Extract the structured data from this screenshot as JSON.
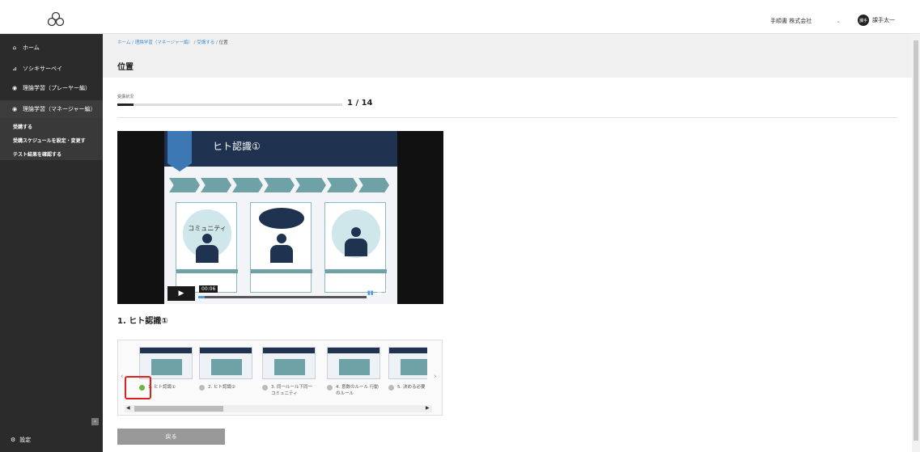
{
  "header": {
    "company": "手順書 株式会社",
    "user_initials": "課手",
    "user_name": "課手太一"
  },
  "sidebar": {
    "items": [
      {
        "icon": "home-icon",
        "glyph": "⌂",
        "label": "ホーム"
      },
      {
        "icon": "chart-icon",
        "glyph": "⊿",
        "label": "ソシキサーベイ"
      },
      {
        "icon": "play-circle-icon",
        "glyph": "◉",
        "label": "理論学習（プレーヤー編）"
      },
      {
        "icon": "play-circle-icon",
        "glyph": "◉",
        "label": "理論学習（マネージャー編）"
      }
    ],
    "sub_items": [
      "受講する",
      "受講スケジュールを設定・変更す",
      "テスト結果を確認する"
    ],
    "settings_label": "設定"
  },
  "breadcrumb": {
    "items": [
      "ホーム",
      "理論学習（マネージャー編）",
      "受講する"
    ],
    "current": "位置"
  },
  "page": {
    "title": "位置",
    "progress_label": "受講状況",
    "progress_value": 0.0714,
    "progress_count": "1 / 14"
  },
  "video": {
    "slide_title": "ヒト認識①",
    "steps": [
      "",
      "",
      "",
      "",
      "",
      "",
      ""
    ],
    "panel_text": "コミュニティ",
    "time": "00:06",
    "played_fraction": 0.04
  },
  "lesson": {
    "title": "1. ヒト認識①",
    "thumbnails": [
      {
        "label": "1. ヒト認識①",
        "done": true
      },
      {
        "label": "2. ヒト認識②",
        "done": false
      },
      {
        "label": "3. 同一ルール下同一コミュニティ",
        "done": false
      },
      {
        "label": "4. 意数のルール 行動のルール",
        "done": false
      },
      {
        "label": "5. 決める必要",
        "done": false
      }
    ]
  },
  "buttons": {
    "back_label": "戻る"
  },
  "colors": {
    "sidebar_bg": "#2b2b2b",
    "complete_green": "#6cb33f",
    "highlight_red": "#e02020",
    "slide_navy": "#1f3250",
    "slide_teal": "#6fa2a6"
  }
}
